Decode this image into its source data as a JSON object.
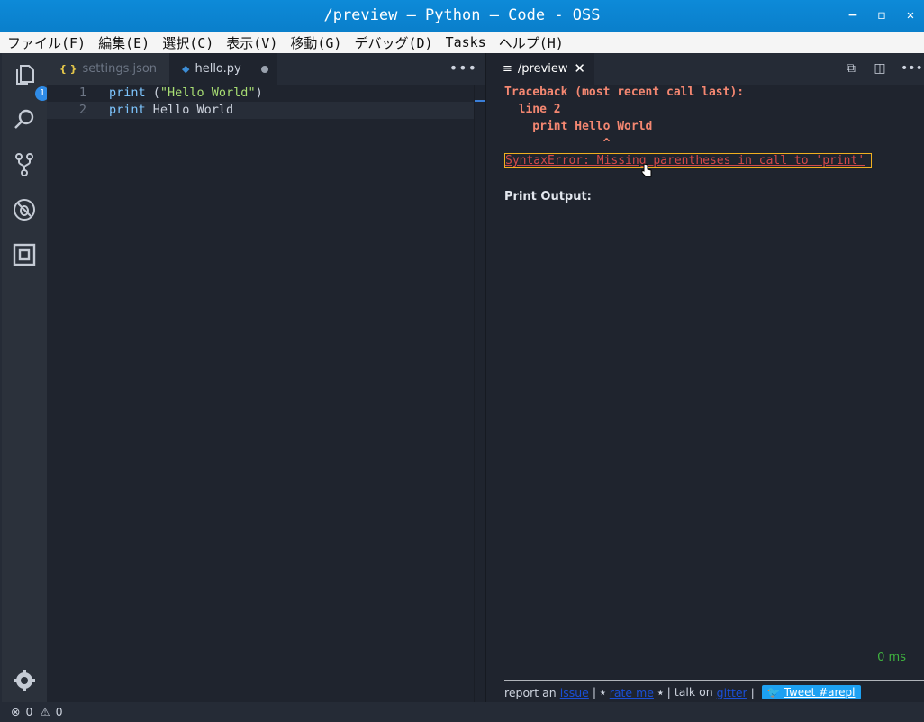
{
  "window": {
    "title": "/preview — Python — Code - OSS"
  },
  "menu": [
    "ファイル(F)",
    "編集(E)",
    "選択(C)",
    "表示(V)",
    "移動(G)",
    "デバッグ(D)",
    "Tasks",
    "ヘルプ(H)"
  ],
  "activity": {
    "explorer_badge": "1"
  },
  "editor": {
    "tabs": [
      {
        "icon": "{ }",
        "label": "settings.json"
      },
      {
        "icon": "py",
        "label": "hello.py"
      }
    ],
    "lines": [
      {
        "num": "1",
        "kw": "print",
        "rest_a": " (",
        "str": "\"Hello World\"",
        "rest_b": ")"
      },
      {
        "num": "2",
        "kw": "print",
        "rest_a": " Hello World",
        "str": "",
        "rest_b": ""
      }
    ]
  },
  "preview": {
    "tab_label": "/preview",
    "traceback": {
      "header": "Traceback (most recent call last):",
      "line": "  line 2",
      "code": "    print Hello World",
      "caret": "              ^",
      "error": "SyntaxError: Missing parentheses in call to 'print'"
    },
    "print_output_label": "Print Output:",
    "time": "0 ms",
    "footer": {
      "prefix": "report an ",
      "issue": "issue",
      "sep1": " | ⭑ ",
      "rate": "rate me",
      "sep2": " ⭑ | talk on ",
      "gitter": "gitter",
      "sep3": " | ",
      "tweet": "Tweet #arepl"
    }
  },
  "status": {
    "errors": "0",
    "warnings": "0"
  }
}
